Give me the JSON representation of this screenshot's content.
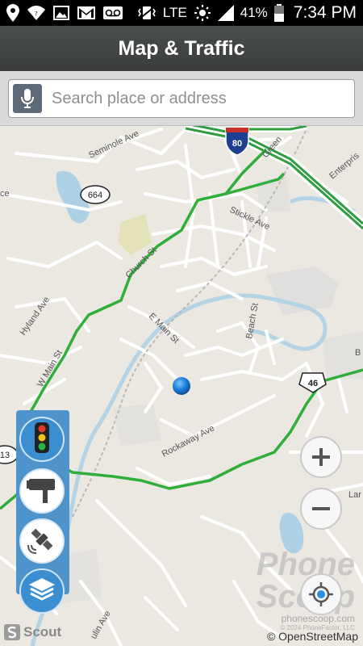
{
  "status_bar": {
    "network": "LTE",
    "battery": "41%",
    "time": "7:34 PM",
    "icons": [
      "location-icon",
      "wifi-icon",
      "image-icon",
      "gmail-icon",
      "voicemail-icon",
      "vibrate-icon",
      "signal-icon",
      "battery-icon"
    ]
  },
  "app_bar": {
    "title": "Map & Traffic"
  },
  "search": {
    "placeholder": "Search place or address",
    "value": ""
  },
  "map": {
    "road_labels": [
      "Seminole Ave",
      "Green",
      "Enterpris",
      "Stickle Ave",
      "Church St",
      "Hyland Ave",
      "W Main St",
      "E Main St",
      "Beach St",
      "Rockaway Ave",
      "ulin Ave",
      "ce",
      "Lar",
      "B"
    ],
    "shields": {
      "interstate": "80",
      "route_664": "664",
      "route_46": "46",
      "route_13": "13"
    },
    "attribution": "© OpenStreetMap",
    "watermark": {
      "line1": "Phone",
      "line2": "Scoop",
      "site": "phonescoop.com",
      "copyright": "© 2024 PhoneFactor, LLC"
    },
    "logo": "Scout"
  },
  "tools": [
    "traffic-light-icon",
    "speed-camera-icon",
    "satellite-icon",
    "layers-icon"
  ],
  "controls": {
    "zoom_in": "+",
    "zoom_out": "−"
  }
}
